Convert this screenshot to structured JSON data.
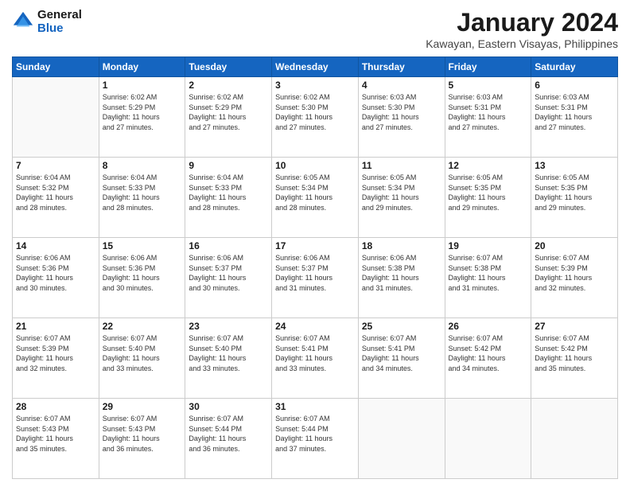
{
  "logo": {
    "line1": "General",
    "line2": "Blue"
  },
  "title": "January 2024",
  "location": "Kawayan, Eastern Visayas, Philippines",
  "weekdays": [
    "Sunday",
    "Monday",
    "Tuesday",
    "Wednesday",
    "Thursday",
    "Friday",
    "Saturday"
  ],
  "weeks": [
    [
      {
        "day": "",
        "info": ""
      },
      {
        "day": "1",
        "info": "Sunrise: 6:02 AM\nSunset: 5:29 PM\nDaylight: 11 hours\nand 27 minutes."
      },
      {
        "day": "2",
        "info": "Sunrise: 6:02 AM\nSunset: 5:29 PM\nDaylight: 11 hours\nand 27 minutes."
      },
      {
        "day": "3",
        "info": "Sunrise: 6:02 AM\nSunset: 5:30 PM\nDaylight: 11 hours\nand 27 minutes."
      },
      {
        "day": "4",
        "info": "Sunrise: 6:03 AM\nSunset: 5:30 PM\nDaylight: 11 hours\nand 27 minutes."
      },
      {
        "day": "5",
        "info": "Sunrise: 6:03 AM\nSunset: 5:31 PM\nDaylight: 11 hours\nand 27 minutes."
      },
      {
        "day": "6",
        "info": "Sunrise: 6:03 AM\nSunset: 5:31 PM\nDaylight: 11 hours\nand 27 minutes."
      }
    ],
    [
      {
        "day": "7",
        "info": "Sunrise: 6:04 AM\nSunset: 5:32 PM\nDaylight: 11 hours\nand 28 minutes."
      },
      {
        "day": "8",
        "info": "Sunrise: 6:04 AM\nSunset: 5:33 PM\nDaylight: 11 hours\nand 28 minutes."
      },
      {
        "day": "9",
        "info": "Sunrise: 6:04 AM\nSunset: 5:33 PM\nDaylight: 11 hours\nand 28 minutes."
      },
      {
        "day": "10",
        "info": "Sunrise: 6:05 AM\nSunset: 5:34 PM\nDaylight: 11 hours\nand 28 minutes."
      },
      {
        "day": "11",
        "info": "Sunrise: 6:05 AM\nSunset: 5:34 PM\nDaylight: 11 hours\nand 29 minutes."
      },
      {
        "day": "12",
        "info": "Sunrise: 6:05 AM\nSunset: 5:35 PM\nDaylight: 11 hours\nand 29 minutes."
      },
      {
        "day": "13",
        "info": "Sunrise: 6:05 AM\nSunset: 5:35 PM\nDaylight: 11 hours\nand 29 minutes."
      }
    ],
    [
      {
        "day": "14",
        "info": "Sunrise: 6:06 AM\nSunset: 5:36 PM\nDaylight: 11 hours\nand 30 minutes."
      },
      {
        "day": "15",
        "info": "Sunrise: 6:06 AM\nSunset: 5:36 PM\nDaylight: 11 hours\nand 30 minutes."
      },
      {
        "day": "16",
        "info": "Sunrise: 6:06 AM\nSunset: 5:37 PM\nDaylight: 11 hours\nand 30 minutes."
      },
      {
        "day": "17",
        "info": "Sunrise: 6:06 AM\nSunset: 5:37 PM\nDaylight: 11 hours\nand 31 minutes."
      },
      {
        "day": "18",
        "info": "Sunrise: 6:06 AM\nSunset: 5:38 PM\nDaylight: 11 hours\nand 31 minutes."
      },
      {
        "day": "19",
        "info": "Sunrise: 6:07 AM\nSunset: 5:38 PM\nDaylight: 11 hours\nand 31 minutes."
      },
      {
        "day": "20",
        "info": "Sunrise: 6:07 AM\nSunset: 5:39 PM\nDaylight: 11 hours\nand 32 minutes."
      }
    ],
    [
      {
        "day": "21",
        "info": "Sunrise: 6:07 AM\nSunset: 5:39 PM\nDaylight: 11 hours\nand 32 minutes."
      },
      {
        "day": "22",
        "info": "Sunrise: 6:07 AM\nSunset: 5:40 PM\nDaylight: 11 hours\nand 33 minutes."
      },
      {
        "day": "23",
        "info": "Sunrise: 6:07 AM\nSunset: 5:40 PM\nDaylight: 11 hours\nand 33 minutes."
      },
      {
        "day": "24",
        "info": "Sunrise: 6:07 AM\nSunset: 5:41 PM\nDaylight: 11 hours\nand 33 minutes."
      },
      {
        "day": "25",
        "info": "Sunrise: 6:07 AM\nSunset: 5:41 PM\nDaylight: 11 hours\nand 34 minutes."
      },
      {
        "day": "26",
        "info": "Sunrise: 6:07 AM\nSunset: 5:42 PM\nDaylight: 11 hours\nand 34 minutes."
      },
      {
        "day": "27",
        "info": "Sunrise: 6:07 AM\nSunset: 5:42 PM\nDaylight: 11 hours\nand 35 minutes."
      }
    ],
    [
      {
        "day": "28",
        "info": "Sunrise: 6:07 AM\nSunset: 5:43 PM\nDaylight: 11 hours\nand 35 minutes."
      },
      {
        "day": "29",
        "info": "Sunrise: 6:07 AM\nSunset: 5:43 PM\nDaylight: 11 hours\nand 36 minutes."
      },
      {
        "day": "30",
        "info": "Sunrise: 6:07 AM\nSunset: 5:44 PM\nDaylight: 11 hours\nand 36 minutes."
      },
      {
        "day": "31",
        "info": "Sunrise: 6:07 AM\nSunset: 5:44 PM\nDaylight: 11 hours\nand 37 minutes."
      },
      {
        "day": "",
        "info": ""
      },
      {
        "day": "",
        "info": ""
      },
      {
        "day": "",
        "info": ""
      }
    ]
  ]
}
